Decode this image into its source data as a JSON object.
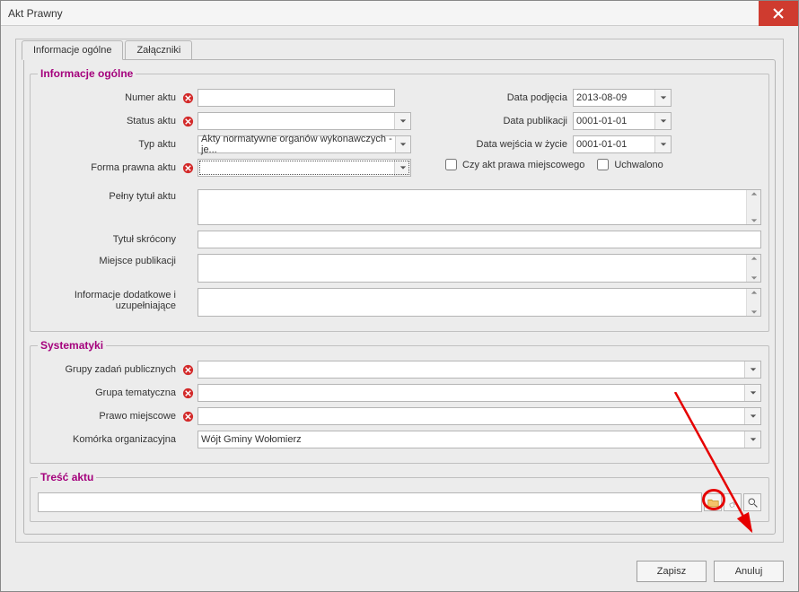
{
  "window": {
    "title": "Akt Prawny"
  },
  "tabs": {
    "general": "Informacje ogólne",
    "attachments": "Załączniki"
  },
  "section_info": {
    "legend": "Informacje ogólne",
    "numer_aktu_label": "Numer aktu",
    "status_aktu_label": "Status aktu",
    "typ_aktu_label": "Typ aktu",
    "typ_aktu_value": "Akty normatywne organów wykonawczych - je...",
    "forma_label": "Forma prawna aktu",
    "data_podjecia_label": "Data podjęcia",
    "data_podjecia_value": "2013-08-09",
    "data_publikacji_label": "Data publikacji",
    "data_publikacji_value": "0001-01-01",
    "data_wejscia_label": "Data wejścia w życie",
    "data_wejscia_value": "0001-01-01",
    "czy_akt_label": "Czy akt prawa miejscowego",
    "uchwalono_label": "Uchwalono",
    "pelny_tytul_label": "Pełny tytuł aktu",
    "tytul_skr_label": "Tytuł skrócony",
    "miejsce_pub_label": "Miejsce publikacji",
    "info_dod_label1": "Informacje dodatkowe i",
    "info_dod_label2": "uzupełniające"
  },
  "section_sys": {
    "legend": "Systematyki",
    "grupy_zadan_label": "Grupy zadań publicznych",
    "grupa_tem_label": "Grupa tematyczna",
    "prawo_miej_label": "Prawo miejscowe",
    "komorka_label": "Komórka organizacyjna",
    "komorka_value": "Wójt Gminy Wołomierz"
  },
  "section_tresc": {
    "legend": "Treść aktu"
  },
  "footer": {
    "save": "Zapisz",
    "cancel": "Anuluj"
  }
}
